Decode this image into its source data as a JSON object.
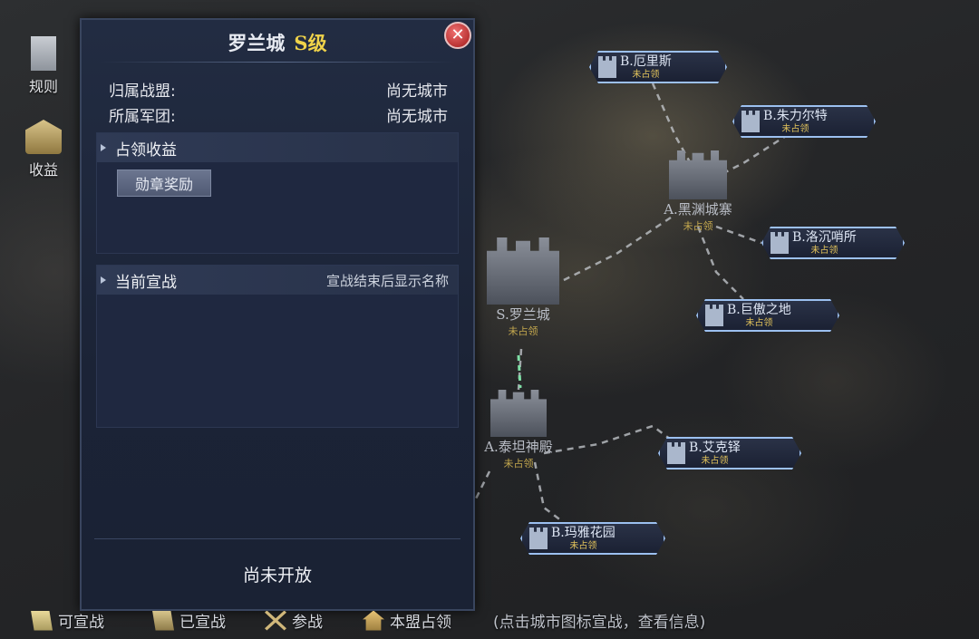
{
  "sidebar": {
    "rules_label": "规则",
    "income_label": "收益"
  },
  "map": {
    "cities_b": [
      {
        "name": "B.厄里斯",
        "status": "未占领"
      },
      {
        "name": "B.朱力尔特",
        "status": "未占领"
      },
      {
        "name": "B.洛沉哨所",
        "status": "未占领"
      },
      {
        "name": "B.巨傲之地",
        "status": "未占领"
      },
      {
        "name": "B.艾克铎",
        "status": "未占领"
      },
      {
        "name": "B.玛雅花园",
        "status": "未占领"
      }
    ],
    "cities_big": [
      {
        "name": "A.黑渊城寨",
        "status": "未占领"
      },
      {
        "name": "S.罗兰城",
        "status": "未占领"
      },
      {
        "name": "A.泰坦神殿",
        "status": "未占领"
      }
    ]
  },
  "panel": {
    "title": "罗兰城",
    "grade": "S级",
    "close_icon": "close-icon",
    "alliance_label": "归属战盟:",
    "alliance_value": "尚无城市",
    "legion_label": "所属军团:",
    "legion_value": "尚无城市",
    "income_header": "占领收益",
    "medal_button": "勋章奖励",
    "war_header": "当前宣战",
    "war_note": "宣战结束后显示名称",
    "status": "尚未开放"
  },
  "legend": {
    "can_declare": "可宣战",
    "declared": "已宣战",
    "participate": "参战",
    "alliance_owned": "本盟占领",
    "hint": "(点击城市图标宣战，查看信息)"
  },
  "colors": {
    "grade": "#f0d34a",
    "unoccupied": "#e2c35b",
    "close": "#c62828",
    "panel_bg": "#1f2840"
  }
}
